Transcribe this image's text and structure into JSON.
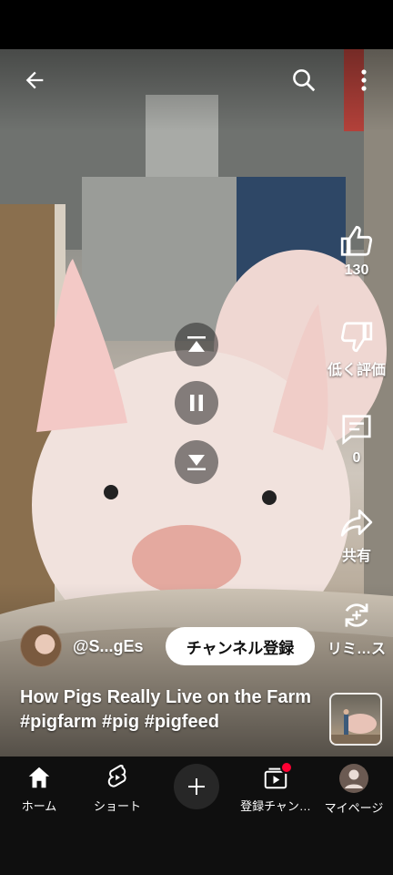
{
  "top": {
    "back_icon": "arrow-left-icon",
    "search_icon": "search-icon",
    "menu_icon": "more-vert-icon"
  },
  "actions": {
    "like_count": "130",
    "dislike_label": "低く評価",
    "comment_count": "0",
    "share_label": "共有",
    "remix_label": "リミ…ス"
  },
  "channel": {
    "handle": "@S...gEs",
    "subscribe_label": "チャンネル登録"
  },
  "video": {
    "title": "How Pigs Really Live on the Farm #pigfarm #pig #pigfeed"
  },
  "nav": {
    "home_label": "ホーム",
    "shorts_label": "ショート",
    "subs_label": "登録チャン…",
    "you_label": "マイページ"
  },
  "colors": {
    "background": "#000000",
    "navbar": "#0f0f0f",
    "badge": "#ff0033",
    "subscribe_bg": "#ffffff"
  }
}
